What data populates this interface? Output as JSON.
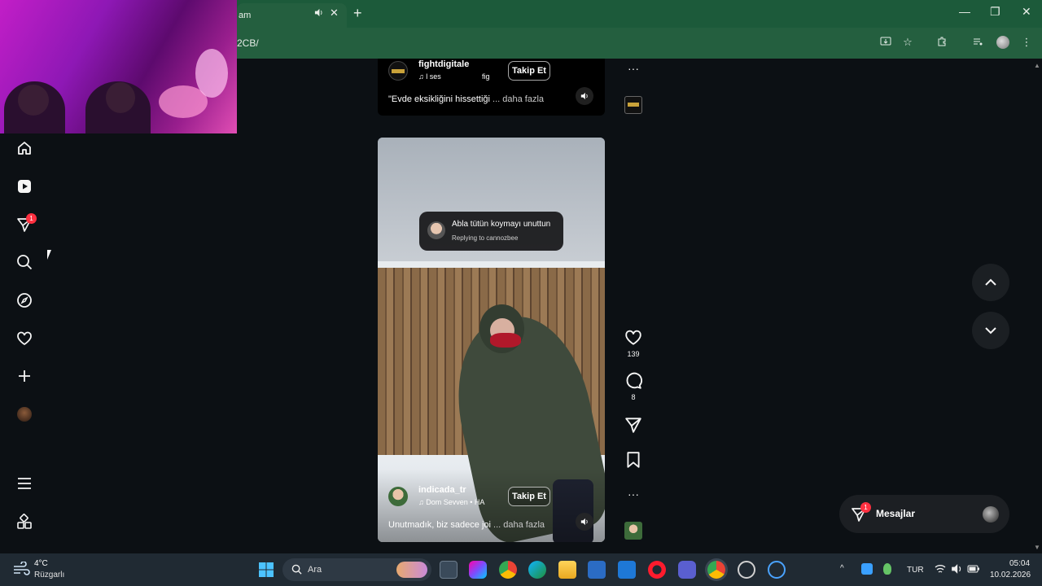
{
  "browser": {
    "tab_title": "am",
    "new_tab_label": "+",
    "tab_close": "✕",
    "address": "2CB/",
    "window_minimize": "—",
    "window_maximize": "❐",
    "window_close": "✕"
  },
  "sidebar": {
    "notifications_badge": "1"
  },
  "top_post": {
    "username": "fightdigitale",
    "audio": "♫ l ses",
    "audio_extra": "fig",
    "follow_label": "Takip Et",
    "caption": "\"Evde eksikliğini hissettiği",
    "more": "... daha fazla"
  },
  "main_post": {
    "reply_text": "Abla tütün koymayı unuttun",
    "reply_sub": "Replying to cannozbee",
    "username": "indicada_tr",
    "audio": "♫ Dom Sevven • HA",
    "follow_label": "Takip Et",
    "caption": "Unutmadık, biz sadece joi",
    "more": "... daha fazla",
    "likes": "139",
    "comments": "8"
  },
  "messages": {
    "label": "Mesajlar",
    "badge": "1"
  },
  "taskbar": {
    "temperature": "4°C",
    "weather": "Rüzgarlı",
    "search_placeholder": "Ara",
    "language": "TUR",
    "time": "05:04",
    "date": "10.02.2026"
  },
  "colors": {
    "chrome_green": "#1c5a3a",
    "feed_bg": "#0c1014",
    "badge_red": "#ff3040"
  }
}
